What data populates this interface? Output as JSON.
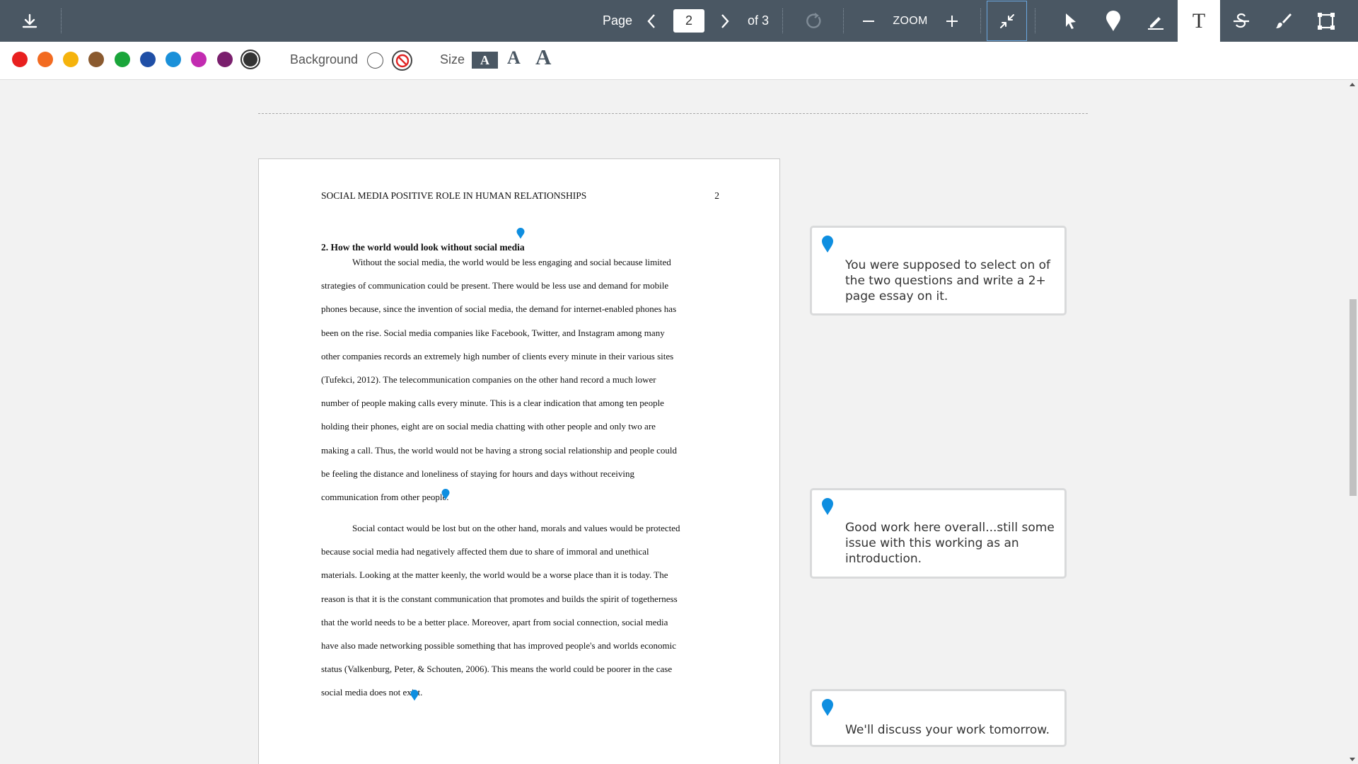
{
  "toolbar": {
    "download_icon": "download-icon",
    "page_label": "Page",
    "current_page": "2",
    "page_total": "of 3",
    "zoom_label": "ZOOM",
    "tools": [
      "cursor-icon",
      "pin-icon",
      "pen-icon",
      "text-icon",
      "strikethrough-icon",
      "brush-icon",
      "area-icon"
    ],
    "active_tool": "text",
    "text_tool_glyph": "T"
  },
  "format_bar": {
    "colors": [
      "#e8201f",
      "#f26b21",
      "#f5b30c",
      "#8a5a2f",
      "#1aa53a",
      "#1f4fa6",
      "#1a90d9",
      "#c22bb0",
      "#7a1f6d",
      "#333333"
    ],
    "selected_color": "#333333",
    "background_label": "Background",
    "size_label": "Size",
    "size_glyph": "A"
  },
  "document": {
    "running_head": "SOCIAL MEDIA POSITIVE ROLE IN HUMAN RELATIONSHIPS",
    "page_number": "2",
    "heading": "2.   How the world would look without social media",
    "paragraph1": [
      "Without the social media, the world would be less engaging and social because limited",
      "strategies of communication could be present. There would be less use and demand for mobile",
      "phones because, since the invention of social media, the demand for internet-enabled phones has",
      "been on the rise. Social media companies like Facebook, Twitter, and Instagram among many",
      "other companies records an extremely high number of clients every minute in their various sites",
      "(Tufekci, 2012). The telecommunication companies on the other hand record a much lower",
      "number of people making calls every minute. This is a clear indication that among ten people",
      "holding their phones, eight are on social media chatting with other people and only two are",
      "making a call. Thus, the world would not be having a strong social relationship and people could",
      "be feeling the distance and loneliness of staying for hours and days without receiving",
      "communication from other people."
    ],
    "paragraph2": [
      "Social contact would be lost but on the other hand, morals and values would be protected",
      "because social media had negatively affected them due to share of immoral and unethical",
      "materials. Looking at the matter keenly, the world would be a worse place than it is today. The",
      "reason is that it is the constant communication that promotes and builds the spirit of togetherness",
      "that the world needs to be a better place. Moreover, apart from social connection, social media",
      "have also made networking possible something that has improved people's and worlds economic",
      "status (Valkenburg, Peter, & Schouten, 2006). This means the world could be poorer in the case",
      "social media does not exist."
    ]
  },
  "comments": [
    {
      "author": "",
      "body": "You were supposed to select on of the two questions and write a 2+ page essay on it."
    },
    {
      "author": "",
      "body": "Good work here overall...still some issue with this working as an introduction."
    },
    {
      "author": "",
      "body": "We'll discuss your work tomorrow."
    }
  ],
  "colors": {
    "toolbar_bg": "#4a5763",
    "pin_blue": "#0e8ee0",
    "active_tool_bg": "#ffffff"
  }
}
